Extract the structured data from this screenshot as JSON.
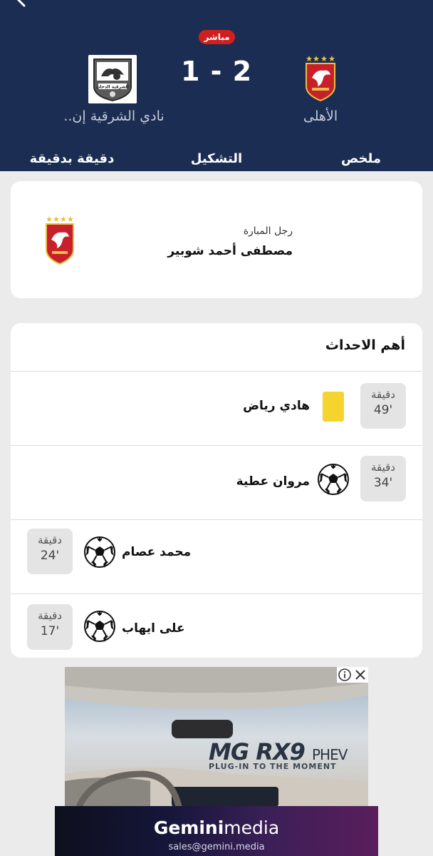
{
  "header": {
    "live_label": "مباشر",
    "score": "1 - 2",
    "home_team": "الأهلى",
    "away_team": "نادي الشرقية إن..",
    "away_logo_text": "الشرقية الدخان",
    "colors": {
      "background": "#1b2d52",
      "live": "#d11f1f"
    }
  },
  "tabs": [
    {
      "label": "ملخص"
    },
    {
      "label": "التشكيل"
    },
    {
      "label": "دقيقة بدقيقة"
    }
  ],
  "man_of_match": {
    "label": "رجل المبارة",
    "name": "مصطفى أحمد شوبير"
  },
  "events": {
    "title": "أهم الاحداث",
    "items": [
      {
        "minute_word": "دقيقة",
        "minute": "49'",
        "player": "هادي رياض",
        "icon": "yellow-card-icon",
        "side": "home"
      },
      {
        "minute_word": "دقيقة",
        "minute": "34'",
        "player": "مروان عطية",
        "icon": "soccer-ball-icon",
        "side": "home"
      },
      {
        "minute_word": "دقيقة",
        "minute": "24'",
        "player": "محمد عصام",
        "icon": "soccer-ball-icon",
        "side": "away"
      },
      {
        "minute_word": "دقيقة",
        "minute": "17'",
        "player": "على ايهاب",
        "icon": "soccer-ball-icon",
        "side": "away"
      }
    ]
  },
  "ad": {
    "brand": "MG RX9",
    "brand_suffix": "PHEV",
    "tagline": "PLUG-IN TO THE MOMENT",
    "footer_brand_bold": "Gemini",
    "footer_brand_light": "media",
    "footer_email": "sales@gemini.media"
  }
}
